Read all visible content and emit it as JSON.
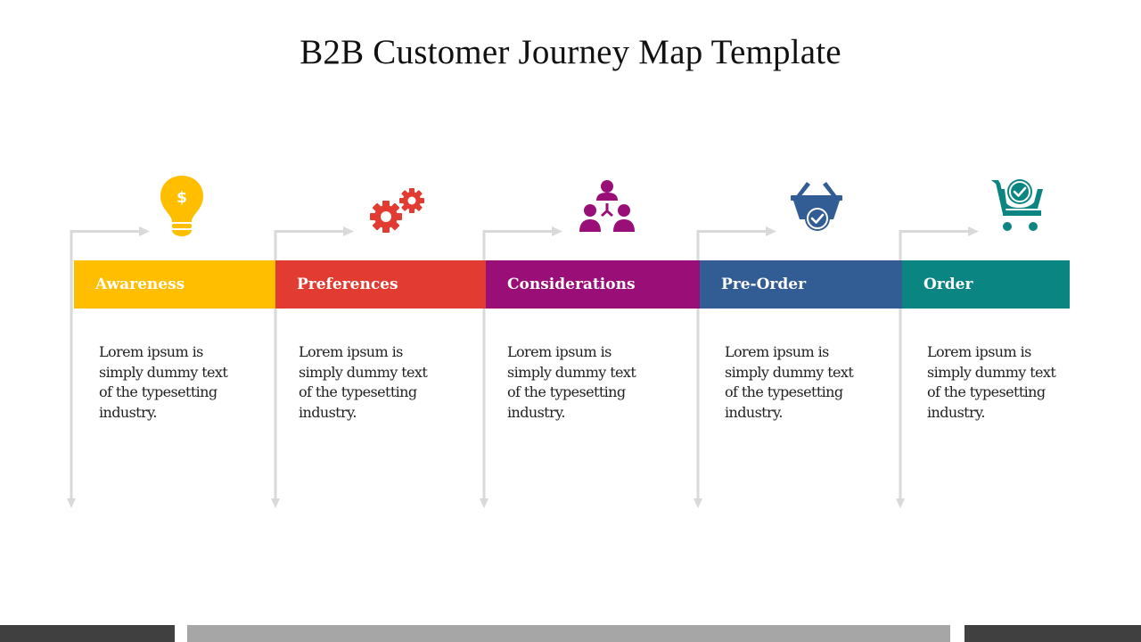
{
  "title": "B2B Customer Journey Map Template",
  "stages": [
    {
      "label": "Awareness",
      "color": "#FFBF00",
      "icon": "lightbulb-dollar-icon",
      "description": "Lorem ipsum is simply dummy text of the typesetting industry."
    },
    {
      "label": "Preferences",
      "color": "#E23B32",
      "icon": "gears-icon",
      "description": "Lorem ipsum is simply dummy text of the typesetting industry."
    },
    {
      "label": "Considerations",
      "color": "#9A0F77",
      "icon": "team-hierarchy-icon",
      "description": "Lorem ipsum is simply dummy text of the typesetting industry."
    },
    {
      "label": "Pre-Order",
      "color": "#325D94",
      "icon": "basket-check-icon",
      "description": "Lorem ipsum is simply dummy text of the typesetting industry."
    },
    {
      "label": "Order",
      "color": "#0B8582",
      "icon": "cart-check-icon",
      "description": "Lorem ipsum is simply dummy text of the typesetting industry."
    }
  ],
  "colors": {
    "connector": "#D9D9D9",
    "footer_dark": "#404040",
    "footer_light": "#A6A6A6"
  }
}
